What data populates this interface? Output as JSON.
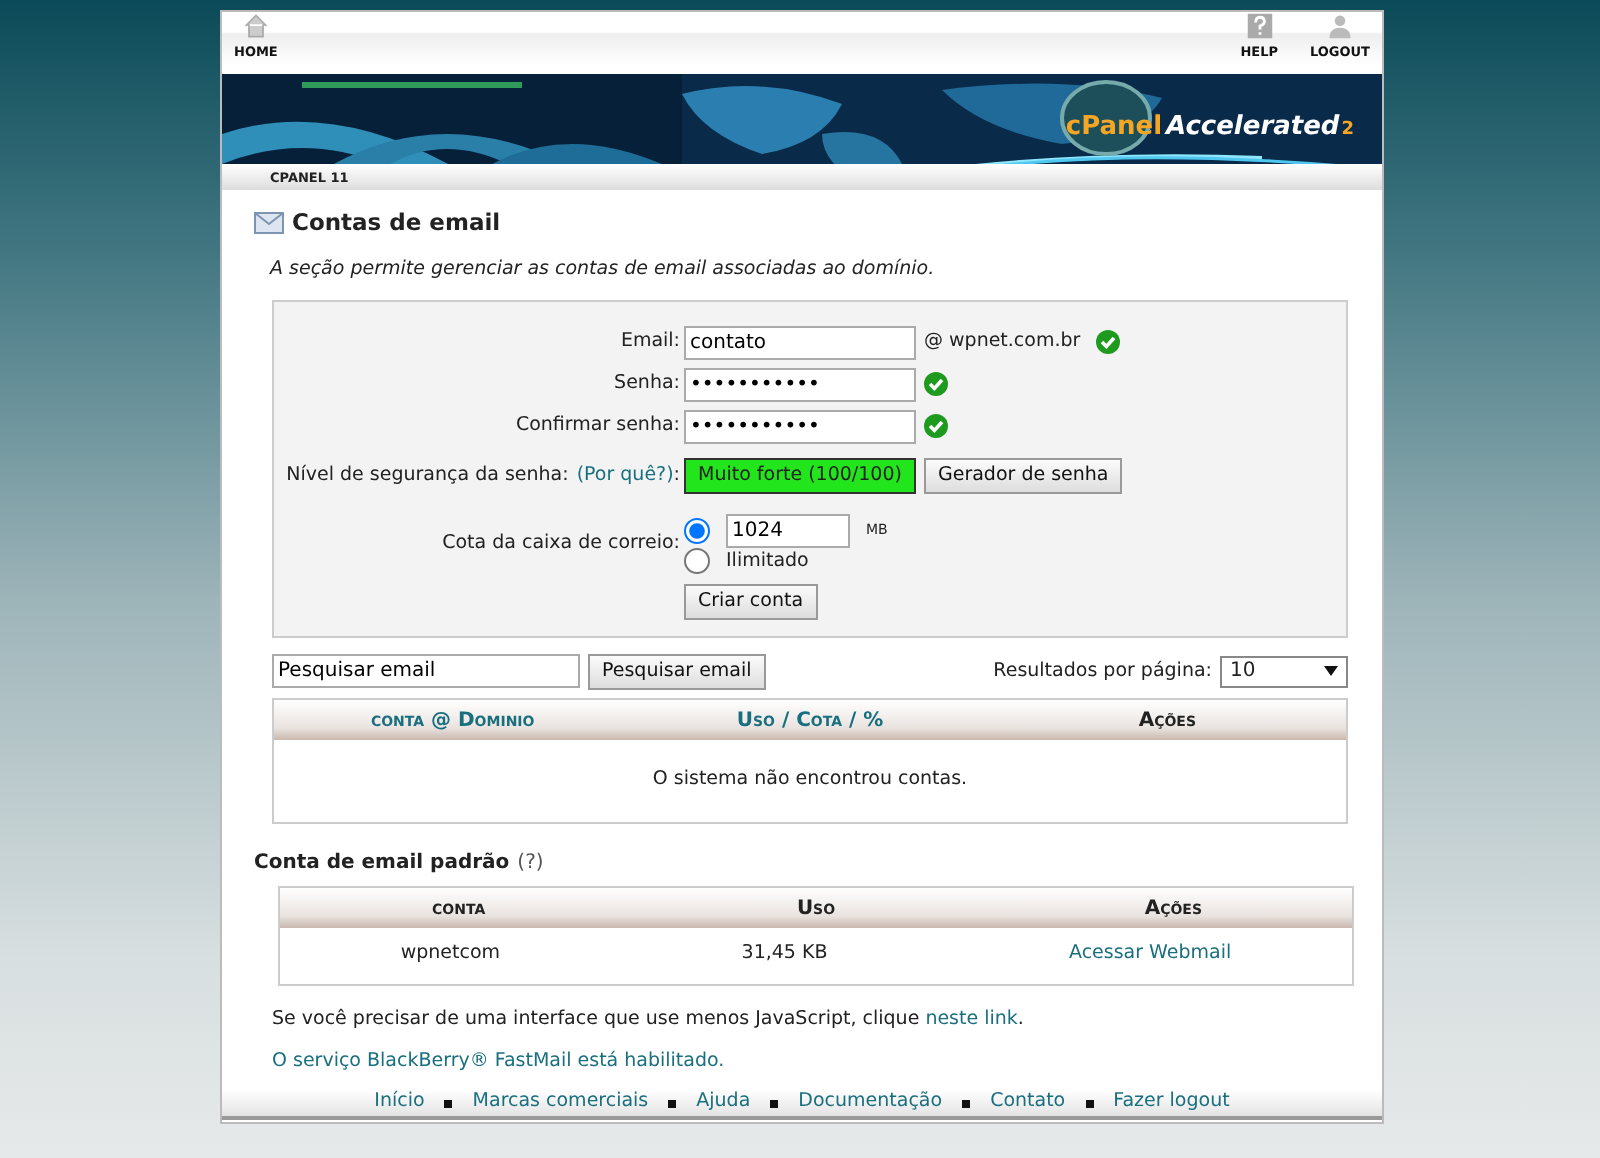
{
  "top_nav": {
    "left": [
      {
        "label": "HOME",
        "kind": "home"
      }
    ],
    "right": [
      {
        "label": "HELP",
        "kind": "help"
      },
      {
        "label": "LOGOUT",
        "kind": "user"
      }
    ]
  },
  "banner": {
    "kind": "picture",
    "logo": "cPanel",
    "product": "Accelerated",
    "version": "2"
  },
  "breadcrumb": "CPANEL 11",
  "heading": "Contas de email",
  "description": "A seção permite gerenciar as contas de email associadas ao domínio.",
  "form": {
    "email": {
      "label": "Email:",
      "value": "contato",
      "suffix": "@ wpnet.com.br",
      "valid": true
    },
    "password": {
      "label": "Senha:",
      "value": "•••••••••••",
      "valid": true
    },
    "confirm": {
      "label": "Confirmar senha:",
      "value": "•••••••••••",
      "valid": true
    },
    "strength": {
      "label": "Nível de segurança da senha:",
      "link": "(Por quê?)",
      "suffix": ":",
      "text": "Muito forte (100/100)",
      "level": 1
    },
    "generator_button": "Gerador de senha",
    "quota": {
      "label": "Cota da caixa de correio:",
      "options": [
        {
          "kind": "number",
          "value": "1024",
          "unit": "MB",
          "selected": true
        },
        {
          "kind": "text",
          "label": "Ilimitado",
          "selected": false
        }
      ]
    },
    "submit": "Criar conta"
  },
  "search": {
    "value": "Pesquisar email",
    "button": "Pesquisar email",
    "per_page_label": "Resultados por página:",
    "per_page": "10"
  },
  "accounts_table": {
    "columns": [
      {
        "label": "conta @ Dominio",
        "kind": "link"
      },
      {
        "label": "Uso / Cota / %",
        "kind": "link"
      },
      {
        "label": "Ações",
        "kind": "text"
      }
    ],
    "empty_message": "O sistema não encontrou contas."
  },
  "default_account": {
    "title": "Conta de email padrão",
    "help": "(?)",
    "columns": [
      "conta",
      "Uso",
      "Ações"
    ],
    "rows": [
      [
        {
          "text": "wpnetcom",
          "kind": "text"
        },
        {
          "text": "31,45 KB",
          "kind": "text"
        },
        {
          "text": "Acessar Webmail",
          "kind": "link"
        }
      ]
    ]
  },
  "notes": [
    {
      "before": "Se você precisar de uma interface que use menos JavaScript, clique ",
      "link": "neste link",
      "after": ".",
      "kind": "sentence"
    },
    {
      "text": "O serviço BlackBerry® FastMail está habilitado.",
      "kind": "link"
    }
  ],
  "footer": [
    "Início",
    "Marcas comerciais",
    "Ajuda",
    "Documentação",
    "Contato",
    "Fazer logout"
  ]
}
